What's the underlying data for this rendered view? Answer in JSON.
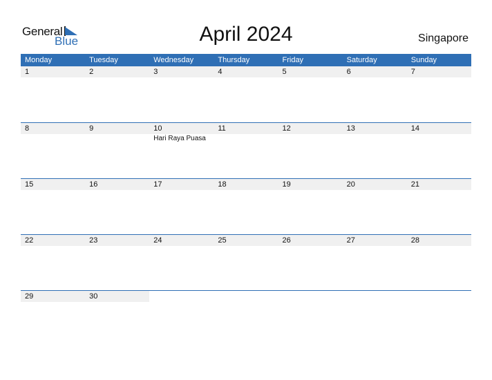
{
  "logo": {
    "general": "General",
    "blue": "Blue"
  },
  "title": "April 2024",
  "country": "Singapore",
  "colors": {
    "accent": "#2f6fb5",
    "strip": "#f0f0f0"
  },
  "weekdays": [
    "Monday",
    "Tuesday",
    "Wednesday",
    "Thursday",
    "Friday",
    "Saturday",
    "Sunday"
  ],
  "weeks": [
    {
      "days": [
        "1",
        "2",
        "3",
        "4",
        "5",
        "6",
        "7"
      ],
      "events": [
        "",
        "",
        "",
        "",
        "",
        "",
        ""
      ]
    },
    {
      "days": [
        "8",
        "9",
        "10",
        "11",
        "12",
        "13",
        "14"
      ],
      "events": [
        "",
        "",
        "Hari Raya Puasa",
        "",
        "",
        "",
        ""
      ]
    },
    {
      "days": [
        "15",
        "16",
        "17",
        "18",
        "19",
        "20",
        "21"
      ],
      "events": [
        "",
        "",
        "",
        "",
        "",
        "",
        ""
      ]
    },
    {
      "days": [
        "22",
        "23",
        "24",
        "25",
        "26",
        "27",
        "28"
      ],
      "events": [
        "",
        "",
        "",
        "",
        "",
        "",
        ""
      ]
    },
    {
      "days": [
        "29",
        "30"
      ],
      "events": [
        "",
        ""
      ]
    }
  ]
}
